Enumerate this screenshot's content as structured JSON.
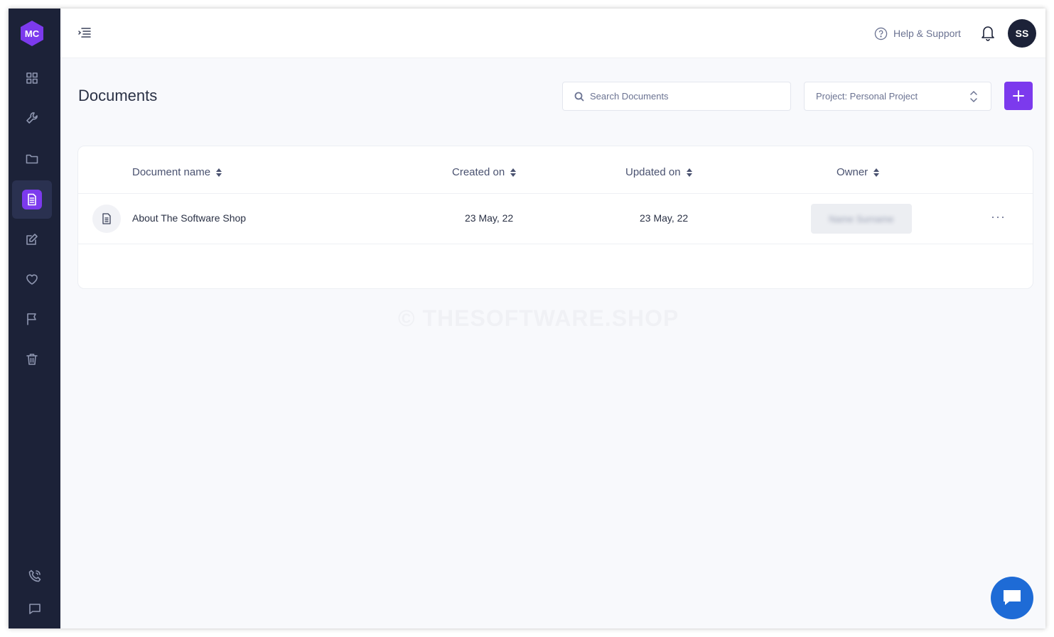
{
  "brand": {
    "logo_text": "MC",
    "accent": "#7c3aed",
    "sidebar_bg": "#1c2238"
  },
  "sidebar": {
    "items": [
      {
        "name": "dashboard",
        "icon": "grid-icon"
      },
      {
        "name": "tools",
        "icon": "wrench-icon"
      },
      {
        "name": "projects",
        "icon": "folder-icon"
      },
      {
        "name": "documents",
        "icon": "document-icon",
        "active": true
      },
      {
        "name": "edit",
        "icon": "edit-icon"
      },
      {
        "name": "favorites",
        "icon": "heart-icon"
      },
      {
        "name": "flags",
        "icon": "flag-icon"
      },
      {
        "name": "trash",
        "icon": "trash-icon"
      }
    ],
    "bottom": [
      {
        "name": "calls",
        "icon": "phone-icon"
      },
      {
        "name": "messages",
        "icon": "chat-icon"
      }
    ]
  },
  "topbar": {
    "help_label": "Help & Support",
    "avatar_initials": "SS"
  },
  "page": {
    "title": "Documents",
    "search_placeholder": "Search Documents",
    "project_select": "Project: Personal Project"
  },
  "table": {
    "columns": [
      "Document name",
      "Created on",
      "Updated on",
      "Owner"
    ],
    "rows": [
      {
        "name": "About The Software Shop",
        "created": "23 May, 22",
        "updated": "23 May, 22",
        "owner": "Name Surname"
      }
    ]
  },
  "watermark": "© THESOFTWARE.SHOP"
}
